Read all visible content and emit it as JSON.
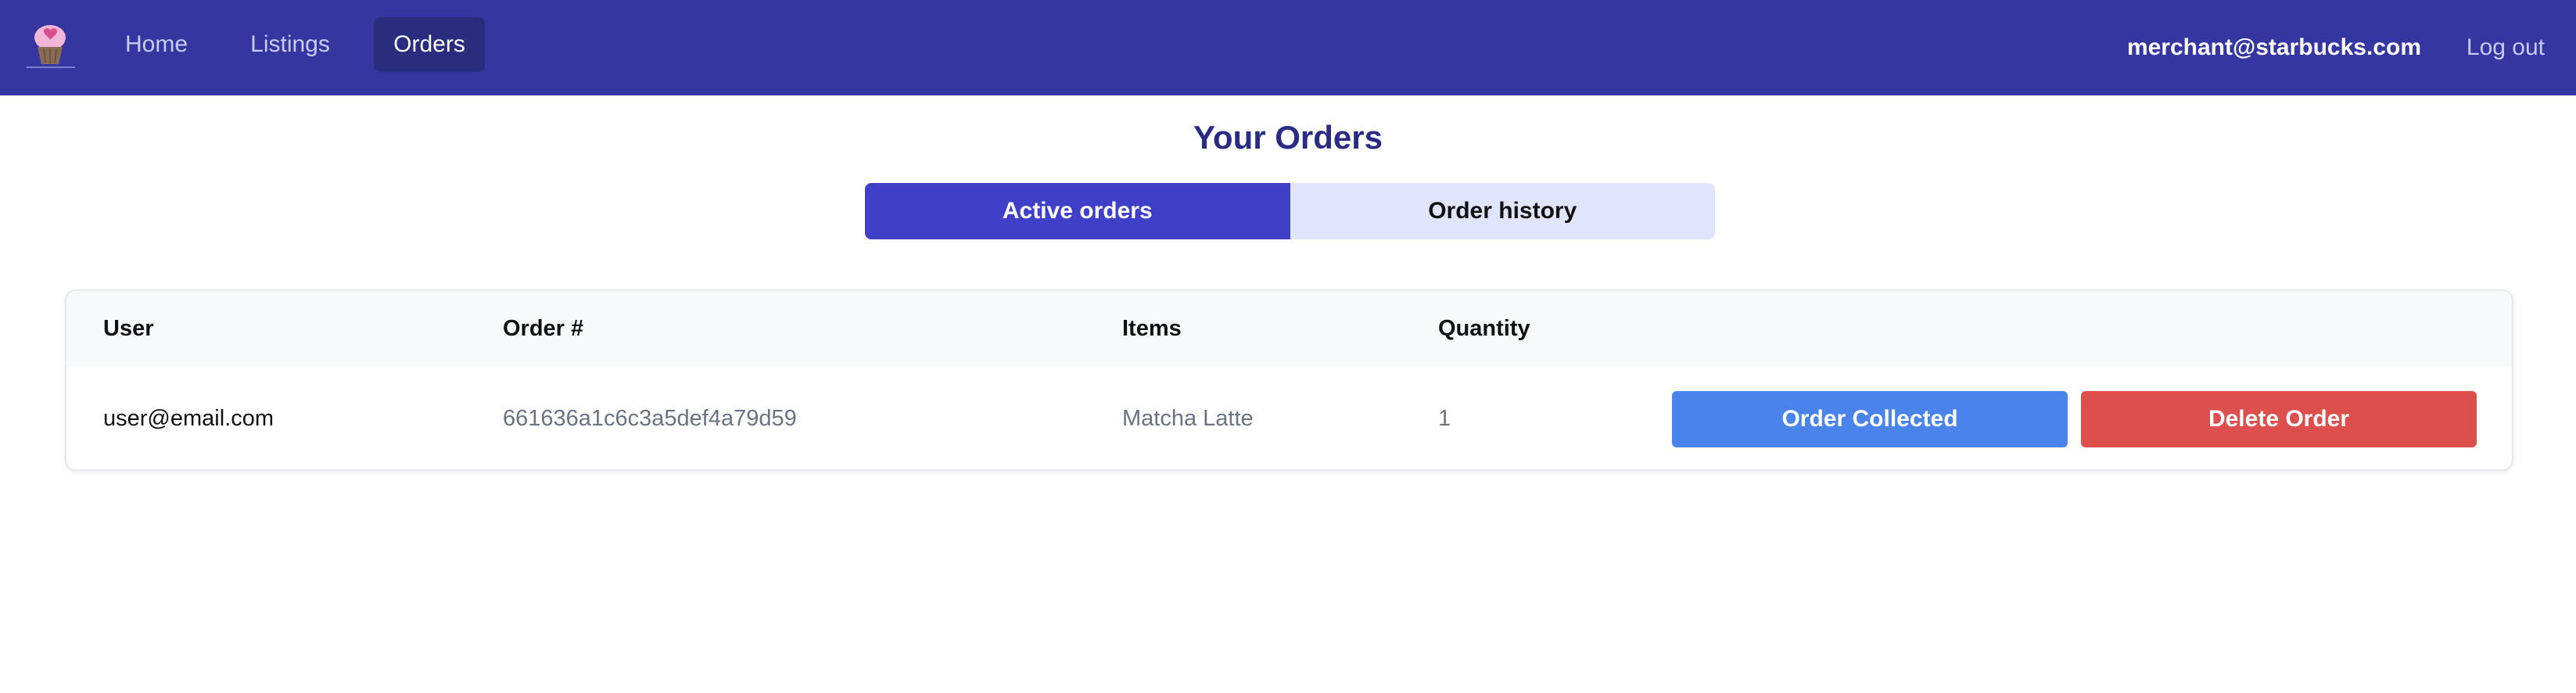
{
  "nav": {
    "home": "Home",
    "listings": "Listings",
    "orders": "Orders",
    "user_email": "merchant@starbucks.com",
    "logout": "Log out",
    "logo_icon": "cupcake-heart-logo",
    "active_color": "#2a2c7e",
    "bg_color": "#3536a0"
  },
  "page": {
    "title": "Your Orders"
  },
  "tabs": [
    {
      "label": "Active orders",
      "active": true
    },
    {
      "label": "Order history",
      "active": false
    }
  ],
  "table": {
    "headers": [
      "User",
      "Order #",
      "Items",
      "Quantity"
    ],
    "rows": [
      {
        "user": "user@email.com",
        "order_id": "661636a1c6c3a5def4a79d59",
        "items": "Matcha Latte",
        "quantity": "1",
        "actions": {
          "collected": "Order Collected",
          "delete": "Delete Order"
        }
      }
    ]
  },
  "colors": {
    "primary": "#3f3fc7",
    "collected": "#4a83ea",
    "delete": "#dc4f4c",
    "title": "#2a2b85"
  }
}
